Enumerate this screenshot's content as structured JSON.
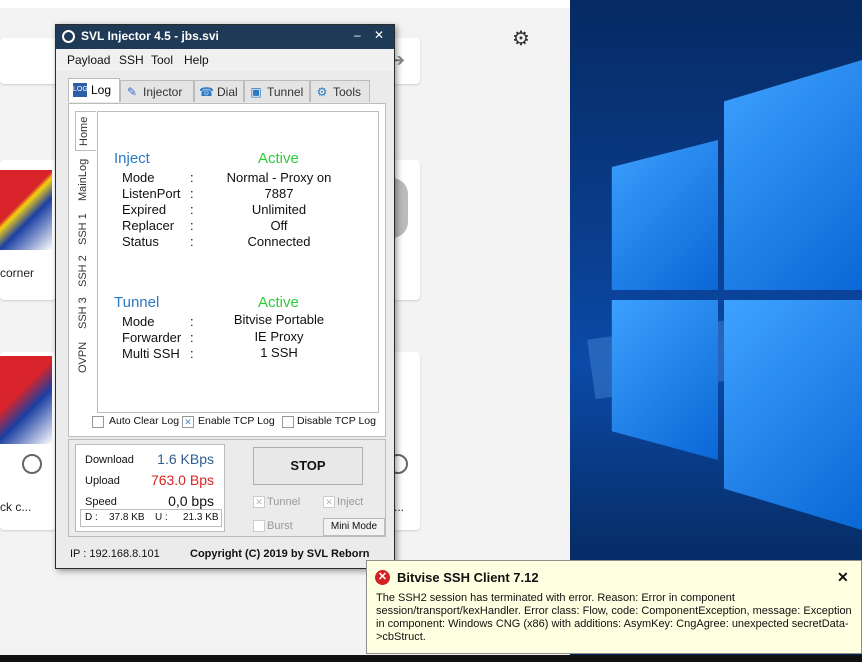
{
  "browser": {
    "cards": [
      {
        "caption": "corner"
      },
      {
        "caption": "ck c..."
      },
      {
        "caption": "..."
      }
    ]
  },
  "window": {
    "title": "SVL Injector 4.5 - jbs.svi",
    "minimize": "–",
    "close": "✕",
    "menu": [
      "Payload",
      "SSH",
      "Tool",
      "Help"
    ],
    "tabs": [
      {
        "label": "Log",
        "icon": "log-icon"
      },
      {
        "label": "Injector",
        "icon": "syringe-icon"
      },
      {
        "label": "Dial",
        "icon": "phone-icon"
      },
      {
        "label": "Tunnel",
        "icon": "monitor-icon"
      },
      {
        "label": "Tools",
        "icon": "tools-icon"
      }
    ],
    "vtabs": [
      "Home",
      "MainLog",
      "SSH 1",
      "SSH 2",
      "SSH 3",
      "OVPN"
    ],
    "inject": {
      "title": "Inject",
      "status": "Active",
      "rows": [
        {
          "label": "Mode",
          "value": "Normal - Proxy on"
        },
        {
          "label": "ListenPort",
          "value": "7887"
        },
        {
          "label": "Expired",
          "value": "Unlimited"
        },
        {
          "label": "Replacer",
          "value": "Off"
        },
        {
          "label": "Status",
          "value": "Connected"
        }
      ]
    },
    "tunnel": {
      "title": "Tunnel",
      "status": "Active",
      "rows": [
        {
          "label": "Mode",
          "value": "Bitvise Portable"
        },
        {
          "label": "Forwarder",
          "value": "IE Proxy"
        },
        {
          "label": "Multi SSH",
          "value": "1 SSH"
        }
      ]
    },
    "colon": ":",
    "checkboxes": [
      {
        "label": "Auto Clear Log",
        "checked": false
      },
      {
        "label": "Enable TCP Log",
        "checked": true
      },
      {
        "label": "Disable TCP Log",
        "checked": false
      }
    ],
    "stats": {
      "download_label": "Download",
      "download_value": "1.6 KBps",
      "upload_label": "Upload",
      "upload_value": "763.0 Bps",
      "speed_label": "Speed",
      "speed_value": "0,0 bps",
      "d_label": "D :",
      "d_value": "37.8 KB",
      "u_label": "U :",
      "u_value": "21.3 KB"
    },
    "stop_label": "STOP",
    "options": {
      "tunnel": "Tunnel",
      "inject": "Inject",
      "burst": "Burst"
    },
    "mini_mode": "Mini Mode",
    "ip": "IP : 192.168.8.101",
    "copyright": "Copyright (C) 2019 by SVL Reborn"
  },
  "toast": {
    "title": "Bitvise SSH Client 7.12",
    "body": "The SSH2 session has terminated with error. Reason: Error in component session/transport/kexHandler. Error class: Flow, code: ComponentException, message: Exception in component: Windows CNG (x86) with additions: AsymKey: CngAgree: unexpected secretData->cbStruct.",
    "close": "✕"
  },
  "colors": {
    "inject_title": "#2a79c4",
    "active": "#2ecb3a",
    "upload": "#d9241f",
    "titlebar": "#1f3a57",
    "toast_bg": "#ffffe1"
  }
}
